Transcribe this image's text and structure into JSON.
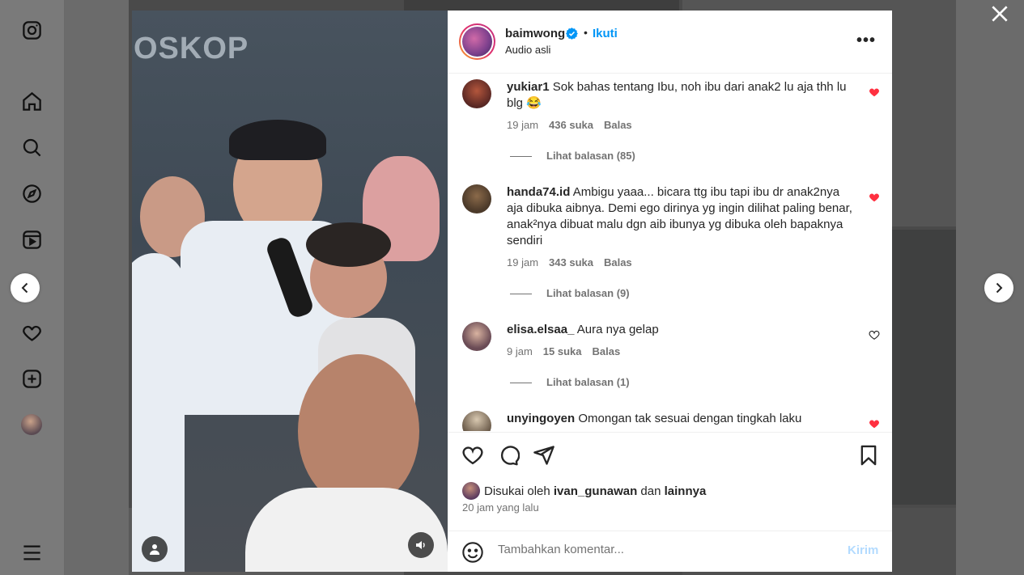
{
  "nav": {
    "items": [
      {
        "name": "instagram-logo-icon"
      },
      {
        "name": "home-icon"
      },
      {
        "name": "search-icon"
      },
      {
        "name": "explore-icon"
      },
      {
        "name": "reels-icon"
      },
      {
        "name": "messenger-icon"
      },
      {
        "name": "notifications-heart-icon"
      },
      {
        "name": "create-icon"
      },
      {
        "name": "profile-avatar"
      },
      {
        "name": "more-menu-icon"
      }
    ]
  },
  "video": {
    "brand_text": "OSKOP"
  },
  "post": {
    "username": "baimwong",
    "separator": "•",
    "follow_label": "Ikuti",
    "audio": "Audio asli",
    "more_label": "•••"
  },
  "comments": [
    {
      "username": "yukiar1",
      "text": "Sok bahas tentang Ibu, noh ibu dari anak2 lu aja thh lu blg 😂",
      "time": "19 jam",
      "likes": "436 suka",
      "reply": "Balas",
      "view_replies": "Lihat balasan (85)",
      "liked": true
    },
    {
      "username": "handa74.id",
      "text": "Ambigu yaaa... bicara ttg ibu tapi ibu dr anak2nya aja dibuka aibnya. Demi ego dirinya yg ingin dilihat paling benar, anak²nya dibuat malu dgn aib ibunya yg dibuka oleh bapaknya sendiri",
      "time": "19 jam",
      "likes": "343 suka",
      "reply": "Balas",
      "view_replies": "Lihat balasan (9)",
      "liked": true
    },
    {
      "username": "elisa.elsaa_",
      "text": "Aura nya gelap",
      "time": "9 jam",
      "likes": "15 suka",
      "reply": "Balas",
      "view_replies": "Lihat balasan (1)",
      "liked": false
    },
    {
      "username": "unyingoyen",
      "text": "Omongan tak sesuai dengan tingkah laku",
      "liked": true
    }
  ],
  "likes": {
    "prefix": "Disukai oleh",
    "user": "ivan_gunawan",
    "joiner": "dan",
    "others": "lainnya"
  },
  "posted_ago": "20 jam yang lalu",
  "add_comment": {
    "placeholder": "Tambahkan komentar...",
    "send_label": "Kirim"
  },
  "colors": {
    "accent": "#0095f6",
    "heart": "#ff3040",
    "send_disabled": "#b3dbff"
  }
}
